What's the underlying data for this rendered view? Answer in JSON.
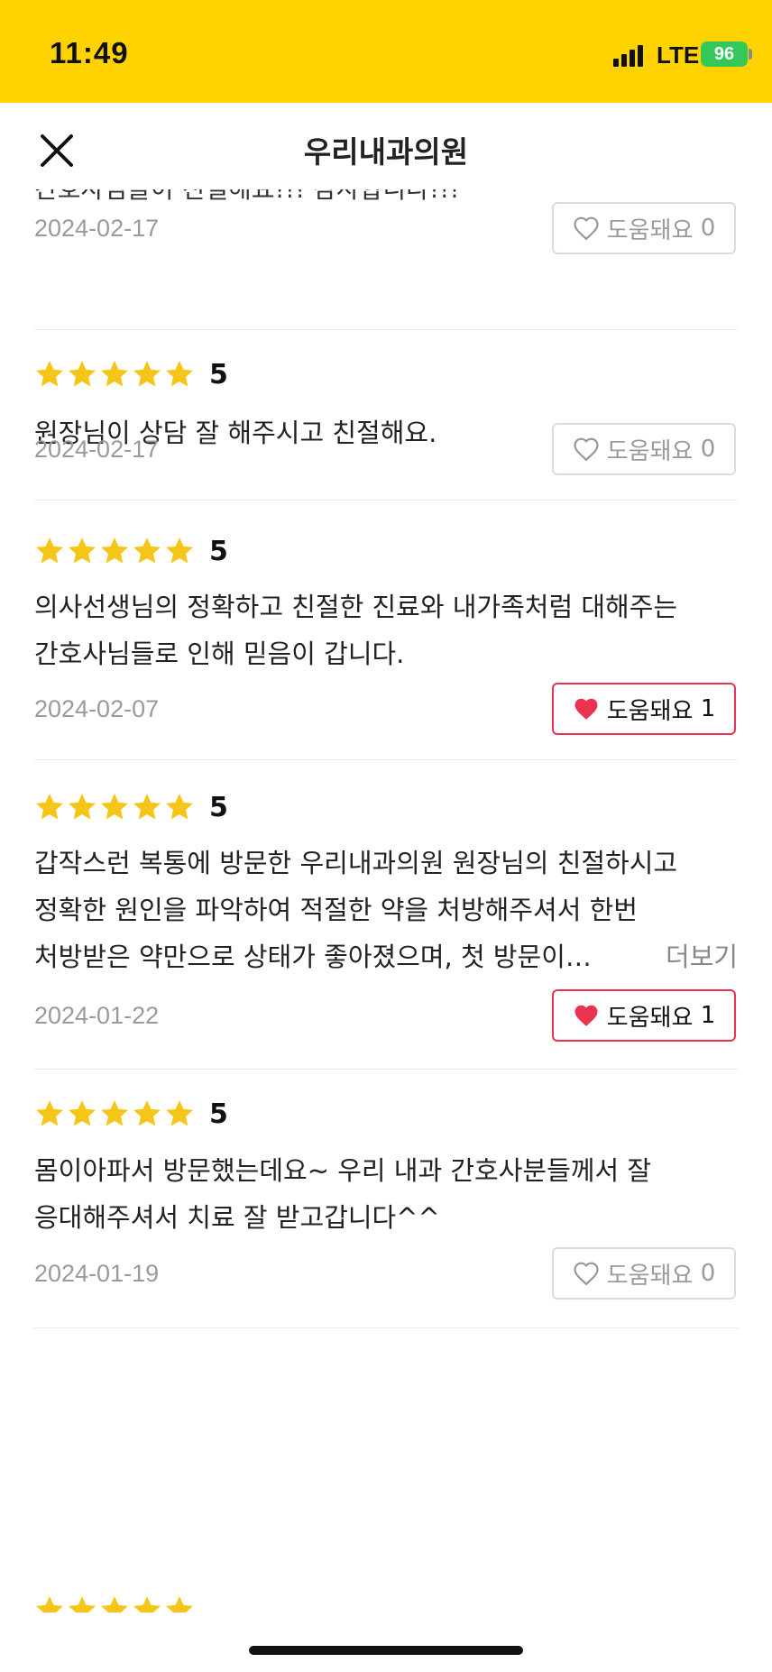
{
  "status_bar": {
    "time": "11:49",
    "network": "LTE",
    "battery": "96"
  },
  "header": {
    "title": "우리내과의원",
    "close_icon": "close-icon"
  },
  "partial_review": {
    "text": "간호사님들이 친절해요!!! 감사합니다!!!",
    "date": "2024-02-17",
    "helpful_label": "도움돼요",
    "helpful_count": "0"
  },
  "reviews": [
    {
      "rating": 5,
      "score": "5",
      "text": "원장님이 상담 잘 해주시고 친절해요.",
      "date": "2024-02-17",
      "helpful_label": "도움돼요",
      "helpful_count": "0",
      "liked": false
    },
    {
      "rating": 5,
      "score": "5",
      "text": "의사선생님의 정확하고 친절한 진료와  내가족처럼 대해주는 간호사님들로 인해  믿음이 갑니다.",
      "date": "2024-02-07",
      "helpful_label": "도움돼요",
      "helpful_count": "1",
      "liked": true
    },
    {
      "rating": 5,
      "score": "5",
      "text": "갑작스런 복통에 방문한 우리내과의원 원장님의 친절하시고 정확한 원인을 파악하여 적절한 약을 처방해주셔서 한번 처방받은 약만으로 상태가 좋아졌으며, 첫 방문이…",
      "more_label": "더보기",
      "date": "2024-01-22",
      "helpful_label": "도움돼요",
      "helpful_count": "1",
      "liked": true
    },
    {
      "rating": 5,
      "score": "5",
      "text": "몸이아파서 방문했는데요~ 우리 내과 간호사분들께서 잘 응대해주셔서 치료 잘 받고갑니다^^",
      "date": "2024-01-19",
      "helpful_label": "도움돼요",
      "helpful_count": "0",
      "liked": false
    }
  ],
  "colors": {
    "brand": "#ffd200",
    "star": "#f5c518",
    "like_active": "#e8344e"
  }
}
